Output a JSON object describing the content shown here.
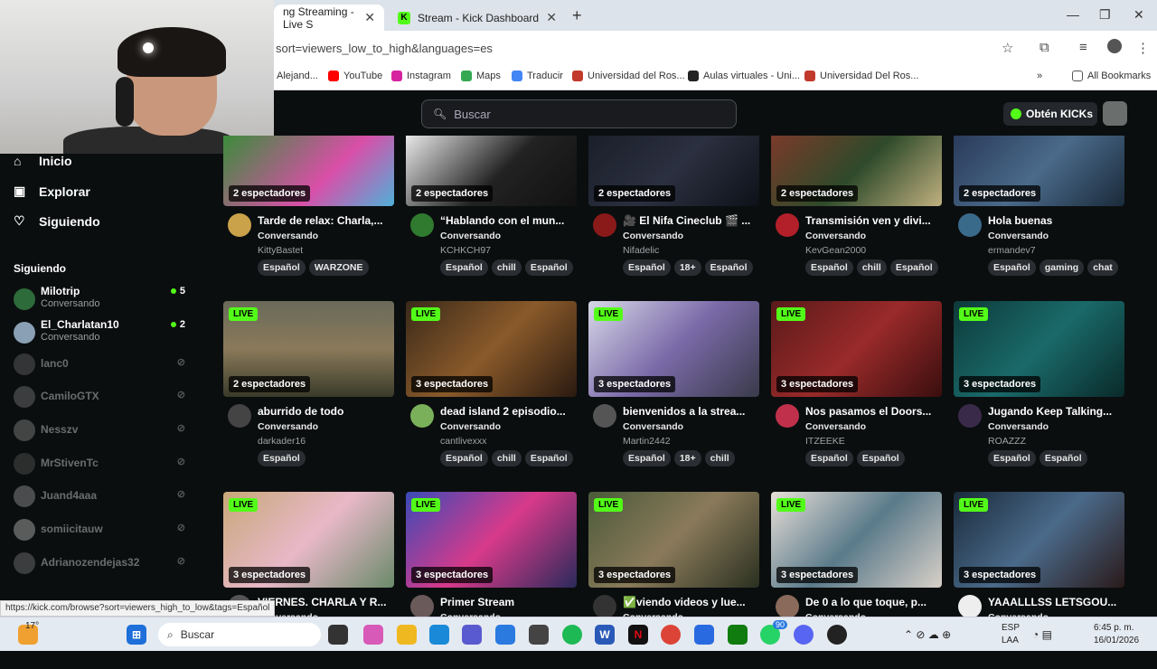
{
  "browser": {
    "tabs": [
      {
        "title": "ng Streaming - Live S"
      },
      {
        "title": "Stream - Kick Dashboard"
      }
    ],
    "url": "sort=viewers_low_to_high&languages=es",
    "bookmarks": [
      {
        "label": "Alejand...",
        "color": "#3b7bd8"
      },
      {
        "label": "YouTube",
        "color": "#ff0000"
      },
      {
        "label": "Instagram",
        "color": "#d6249f"
      },
      {
        "label": "Maps",
        "color": "#34a853"
      },
      {
        "label": "Traducir",
        "color": "#4285f4"
      },
      {
        "label": "Universidad del Ros...",
        "color": "#c0392b"
      },
      {
        "label": "Aulas virtuales - Uni...",
        "color": "#222222"
      },
      {
        "label": "Universidad Del Ros...",
        "color": "#c0392b"
      }
    ],
    "all_bookmarks": "All Bookmarks"
  },
  "header": {
    "search_placeholder": "Buscar",
    "kicks_button": "Obtén KICKs"
  },
  "sidebar": {
    "nav": [
      {
        "label": "Inicio",
        "icon": "home-icon"
      },
      {
        "label": "Explorar",
        "icon": "compass-icon"
      },
      {
        "label": "Siguiendo",
        "icon": "heart-icon"
      }
    ],
    "following_title": "Siguiendo",
    "channels": [
      {
        "name": "Milotrip",
        "category": "Conversando",
        "count": "5",
        "live": true,
        "color": "#2e6b3a"
      },
      {
        "name": "El_Charlatan10",
        "category": "Conversando",
        "count": "2",
        "live": true,
        "color": "#8aa0b5"
      },
      {
        "name": "lanc0",
        "live": false,
        "color": "#666"
      },
      {
        "name": "CamiloGTX",
        "live": false,
        "color": "#777"
      },
      {
        "name": "Nesszv",
        "live": false,
        "color": "#888"
      },
      {
        "name": "MrStivenTc",
        "live": false,
        "color": "#555"
      },
      {
        "name": "Juand4aaa",
        "live": false,
        "color": "#999"
      },
      {
        "name": "somiicitauw",
        "live": false,
        "color": "#bbb"
      },
      {
        "name": "Adrianozendejas32",
        "live": false,
        "color": "#777"
      }
    ]
  },
  "streams": [
    {
      "live": false,
      "viewers": "2 espectadores",
      "title": "Tarde de relax: Charla,...",
      "category": "Conversando",
      "user": "KittyBastet",
      "tags": [
        "Español",
        "WARZONE"
      ],
      "thumb": "linear-gradient(135deg,#3a8c3a,#d94fa8 60%,#4fb0d9)",
      "avatar": "#c9a24a"
    },
    {
      "live": false,
      "viewers": "2 espectadores",
      "title": "“Hablando con el mun...",
      "category": "Conversando",
      "user": "KCHKCH97",
      "tags": [
        "Español",
        "chill",
        "Español"
      ],
      "thumb": "linear-gradient(135deg,#e8e8e8,#222 55%,#111)",
      "avatar": "#2f7a2f"
    },
    {
      "live": false,
      "viewers": "2 espectadores",
      "title": "🎥 El Nifa Cineclub 🎬 ...",
      "category": "Conversando",
      "user": "Nifadelic",
      "tags": [
        "Español",
        "18+",
        "Español"
      ],
      "thumb": "linear-gradient(135deg,#1a1f2a,#2b3040 50%,#0e1118)",
      "avatar": "#8a1a1a"
    },
    {
      "live": false,
      "viewers": "2 espectadores",
      "title": "Transmisión ven y divi...",
      "category": "Conversando",
      "user": "KevGean2000",
      "tags": [
        "Español",
        "chill",
        "Español"
      ],
      "thumb": "linear-gradient(135deg,#7a3a2a,#2e4a2a 50%,#c0b080)",
      "avatar": "#b3202a"
    },
    {
      "live": false,
      "viewers": "2 espectadores",
      "title": "Hola buenas",
      "category": "Conversando",
      "user": "ermandev7",
      "tags": [
        "Español",
        "gaming",
        "chat"
      ],
      "thumb": "linear-gradient(135deg,#2a3a5a,#4a6a8a 50%,#1a2a3a)",
      "avatar": "#3a6a8a"
    },
    {
      "live": true,
      "viewers": "2 espectadores",
      "title": "aburrido de todo",
      "category": "Conversando",
      "user": "darkader16",
      "tags": [
        "Español"
      ],
      "thumb": "linear-gradient(180deg,#6a6a5a,#8a7a5a 50%,#3a3a2a)",
      "avatar": "#444"
    },
    {
      "live": true,
      "viewers": "3 espectadores",
      "title": "dead island 2 episodio...",
      "category": "Conversando",
      "user": "cantlivexxx",
      "tags": [
        "Español",
        "chill",
        "Español"
      ],
      "thumb": "linear-gradient(135deg,#3a2a1a,#8a5a2a 50%,#2a1a10)",
      "avatar": "#7ab05a"
    },
    {
      "live": true,
      "viewers": "3 espectadores",
      "title": "bienvenidos a la strea...",
      "category": "Conversando",
      "user": "Martin2442",
      "tags": [
        "Español",
        "18+",
        "chill"
      ],
      "thumb": "linear-gradient(135deg,#d8d8e8,#7a6aa8 50%,#3a3a4a)",
      "avatar": "#555"
    },
    {
      "live": true,
      "viewers": "3 espectadores",
      "title": "Nos pasamos el Doors...",
      "category": "Conversando",
      "user": "ITZEEKE",
      "tags": [
        "Español",
        "Español"
      ],
      "thumb": "linear-gradient(135deg,#5a1a1a,#9a2a2a 50%,#3a0e0e)",
      "avatar": "#c0304a"
    },
    {
      "live": true,
      "viewers": "3 espectadores",
      "title": "Jugando Keep Talking...",
      "category": "Conversando",
      "user": "ROAZZZ",
      "tags": [
        "Español",
        "Español"
      ],
      "thumb": "linear-gradient(135deg,#0e3a3a,#1a6a6a 50%,#0a2a2a)",
      "avatar": "#3a2a4a"
    },
    {
      "live": true,
      "viewers": "3 espectadores",
      "title": "VIERNES. CHARLA Y R...",
      "category": "Conversando",
      "user": "",
      "tags": [],
      "thumb": "linear-gradient(135deg,#c8a878,#e8b8c8 50%,#6a8a6a)",
      "avatar": "#555"
    },
    {
      "live": true,
      "viewers": "3 espectadores",
      "title": "Primer Stream",
      "category": "Conversando",
      "user": "",
      "tags": [],
      "thumb": "linear-gradient(135deg,#3a4ab8,#d83a8a 50%,#2a2a5a)",
      "avatar": "#6a5a5a"
    },
    {
      "live": true,
      "viewers": "3 espectadores",
      "title": "✅viendo videos y lue...",
      "category": "Conversando",
      "user": "",
      "tags": [],
      "thumb": "linear-gradient(135deg,#4a5a3a,#8a7a5a 50%,#2a3020)",
      "avatar": "#333"
    },
    {
      "live": true,
      "viewers": "3 espectadores",
      "title": "De 0 a lo que toque, p...",
      "category": "Conversando",
      "user": "",
      "tags": [],
      "thumb": "linear-gradient(135deg,#e8e0d8,#5a7a8a 50%,#d8d0c8)",
      "avatar": "#8a6a5a"
    },
    {
      "live": true,
      "viewers": "3 espectadores",
      "title": "YAAALLLSS LETSGOU...",
      "category": "Conversando",
      "user": "",
      "tags": [],
      "thumb": "linear-gradient(135deg,#1a2a3a,#4a6a8a 50%,#2a1a1a)",
      "avatar": "#eeeeee"
    }
  ],
  "status_link": "https://kick.com/browse?sort=viewers_high_to_low&tags=Español",
  "taskbar": {
    "weather": "17°",
    "search": "Buscar",
    "lang_top": "ESP",
    "lang_bottom": "LAA",
    "time": "6:45 p. m.",
    "date": "16/01/2026",
    "notif_badge": "90"
  }
}
